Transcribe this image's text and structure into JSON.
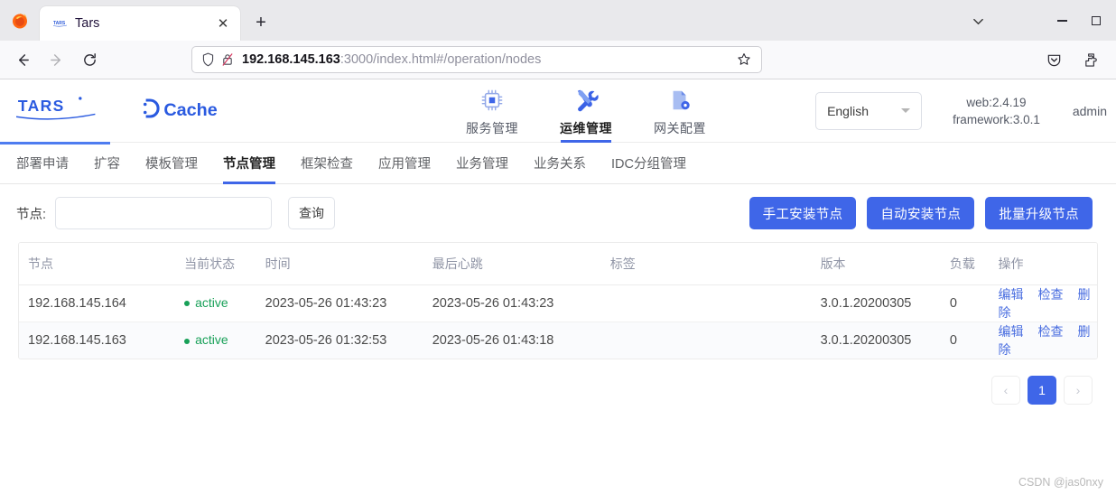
{
  "browser": {
    "tab": {
      "title": "Tars",
      "favicon_icon": "tars-favicon",
      "close_icon": "close-icon"
    },
    "new_tab_icon": "plus-icon",
    "list_all_tabs_icon": "chevron-down-icon",
    "window_controls": {
      "minimize_icon": "minimize-icon",
      "maximize_icon": "maximize-icon"
    },
    "nav": {
      "back_icon": "back-arrow-icon",
      "forward_icon": "forward-arrow-icon",
      "reload_icon": "reload-icon"
    },
    "urlbar": {
      "shield_icon": "shield-icon",
      "lock_icon": "lock-crossed-icon",
      "host": "192.168.145.163",
      "path": ":3000/index.html#/operation/nodes",
      "star_icon": "star-icon"
    },
    "toolbar_right": {
      "pocket_icon": "pocket-icon",
      "extensions_icon": "extensions-icon"
    }
  },
  "site": {
    "logo_tars": "TARS",
    "logo_dcache": "DCache",
    "header_nav": [
      {
        "label": "服务管理",
        "icon": "chip-icon",
        "active": false
      },
      {
        "label": "运维管理",
        "icon": "wrench-tools-icon",
        "active": true
      },
      {
        "label": "网关配置",
        "icon": "document-gear-icon",
        "active": false
      }
    ],
    "language": {
      "value": "English",
      "caret_icon": "chevron-down-icon"
    },
    "versions": {
      "web": "web:2.4.19",
      "framework": "framework:3.0.1"
    },
    "user": "admin"
  },
  "subtabs": [
    {
      "label": "部署申请",
      "active": false
    },
    {
      "label": "扩容",
      "active": false
    },
    {
      "label": "模板管理",
      "active": false
    },
    {
      "label": "节点管理",
      "active": true
    },
    {
      "label": "框架检查",
      "active": false
    },
    {
      "label": "应用管理",
      "active": false
    },
    {
      "label": "业务管理",
      "active": false
    },
    {
      "label": "业务关系",
      "active": false
    },
    {
      "label": "IDC分组管理",
      "active": false
    }
  ],
  "filter": {
    "label": "节点:",
    "input_value": "",
    "input_placeholder": "",
    "query_button": "查询",
    "actions": [
      "手工安装节点",
      "自动安装节点",
      "批量升级节点"
    ]
  },
  "table": {
    "headers": [
      "节点",
      "当前状态",
      "时间",
      "最后心跳",
      "标签",
      "版本",
      "负载",
      "操作"
    ],
    "rows": [
      {
        "node": "192.168.145.164",
        "status": "active",
        "time": "2023-05-26 01:43:23",
        "heartbeat": "2023-05-26 01:43:23",
        "tag": "",
        "version": "3.0.1.20200305",
        "load": "0",
        "ops": [
          "编辑",
          "检查",
          "删除"
        ]
      },
      {
        "node": "192.168.145.163",
        "status": "active",
        "time": "2023-05-26 01:32:53",
        "heartbeat": "2023-05-26 01:43:18",
        "tag": "",
        "version": "3.0.1.20200305",
        "load": "0",
        "ops": [
          "编辑",
          "检查",
          "删除"
        ]
      }
    ]
  },
  "pagination": {
    "prev": "‹",
    "pages": [
      "1"
    ],
    "next": "›",
    "current": "1"
  },
  "watermark": "CSDN @jas0nxy",
  "colors": {
    "accent_blue": "#3f66e8",
    "status_green": "#18a058",
    "link_blue": "#4a6ee0",
    "header_gray": "#9095a6"
  }
}
